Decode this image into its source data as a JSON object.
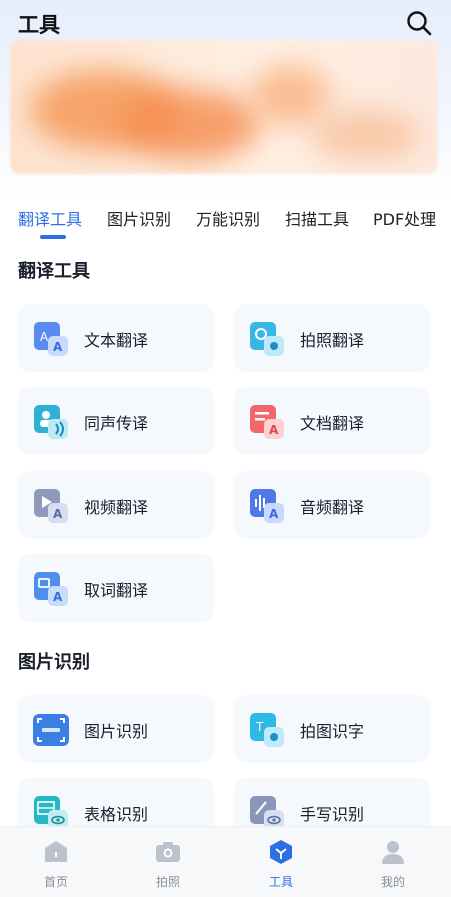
{
  "header": {
    "title": "工具",
    "search_icon": "search-icon"
  },
  "tabs": [
    {
      "label": "翻译工具",
      "active": true
    },
    {
      "label": "图片识别",
      "active": false
    },
    {
      "label": "万能识别",
      "active": false
    },
    {
      "label": "扫描工具",
      "active": false
    },
    {
      "label": "PDF处理",
      "active": false
    }
  ],
  "sections": [
    {
      "title": "翻译工具",
      "items": [
        {
          "label": "文本翻译",
          "icon": "text-translate-icon"
        },
        {
          "label": "拍照翻译",
          "icon": "photo-translate-icon"
        },
        {
          "label": "同声传译",
          "icon": "simultaneous-interpret-icon"
        },
        {
          "label": "文档翻译",
          "icon": "document-translate-icon"
        },
        {
          "label": "视频翻译",
          "icon": "video-translate-icon"
        },
        {
          "label": "音频翻译",
          "icon": "audio-translate-icon"
        },
        {
          "label": "取词翻译",
          "icon": "word-pick-translate-icon"
        }
      ]
    },
    {
      "title": "图片识别",
      "items": [
        {
          "label": "图片识别",
          "icon": "image-recognize-icon"
        },
        {
          "label": "拍图识字",
          "icon": "photo-text-recognize-icon"
        },
        {
          "label": "表格识别",
          "icon": "table-recognize-icon"
        },
        {
          "label": "手写识别",
          "icon": "handwriting-recognize-icon"
        }
      ]
    }
  ],
  "bottom_nav": [
    {
      "label": "首页",
      "icon": "home-icon",
      "active": false
    },
    {
      "label": "拍照",
      "icon": "camera-icon",
      "active": false
    },
    {
      "label": "工具",
      "icon": "tools-icon",
      "active": true
    },
    {
      "label": "我的",
      "icon": "profile-icon",
      "active": false
    }
  ],
  "colors": {
    "accent": "#2f6fe6",
    "card_bg": "#f5f8fd"
  }
}
